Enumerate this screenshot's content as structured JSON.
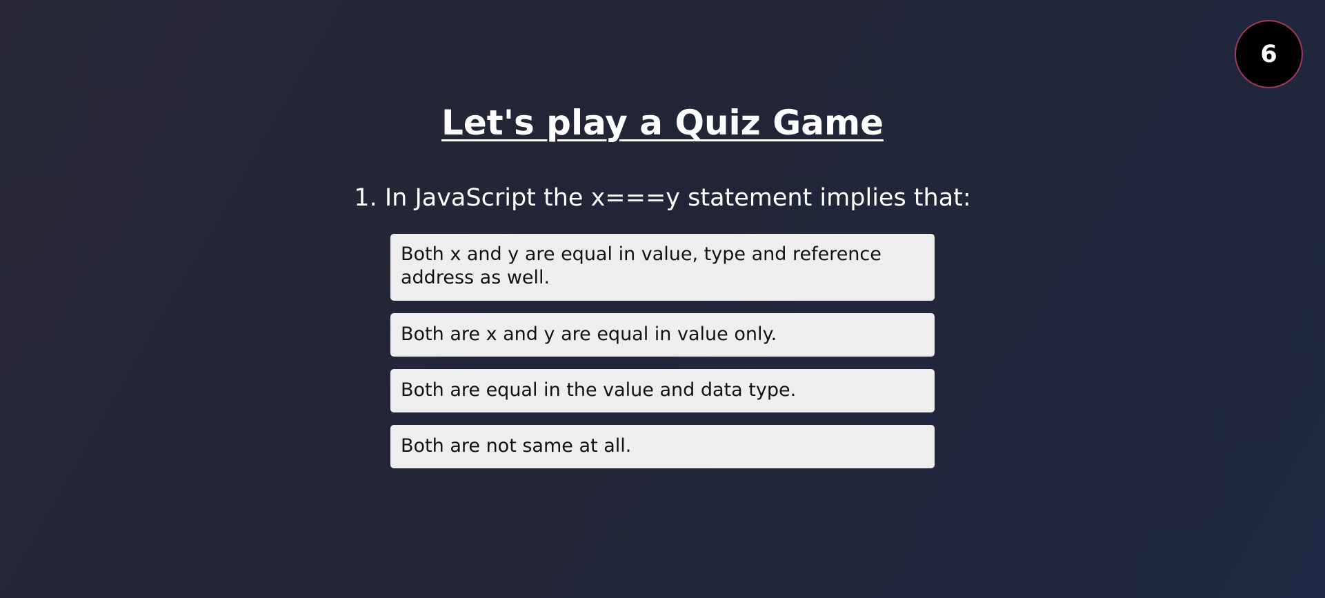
{
  "timer": {
    "value": "6"
  },
  "header": {
    "title": "Let's play a Quiz Game"
  },
  "quiz": {
    "question": "1. In JavaScript the x===y statement implies that:",
    "options": [
      {
        "label": "Both x and y are equal in value, type and reference address as well."
      },
      {
        "label": "Both are x and y are equal in value only."
      },
      {
        "label": "Both are equal in the value and data type."
      },
      {
        "label": "Both are not same at all."
      }
    ]
  },
  "colors": {
    "background_start": "#272735",
    "background_end": "#1f2742",
    "option_background": "#eeeeee",
    "timer_background": "#000000",
    "timer_border": "#a03a5a",
    "text": "#ffffff"
  }
}
